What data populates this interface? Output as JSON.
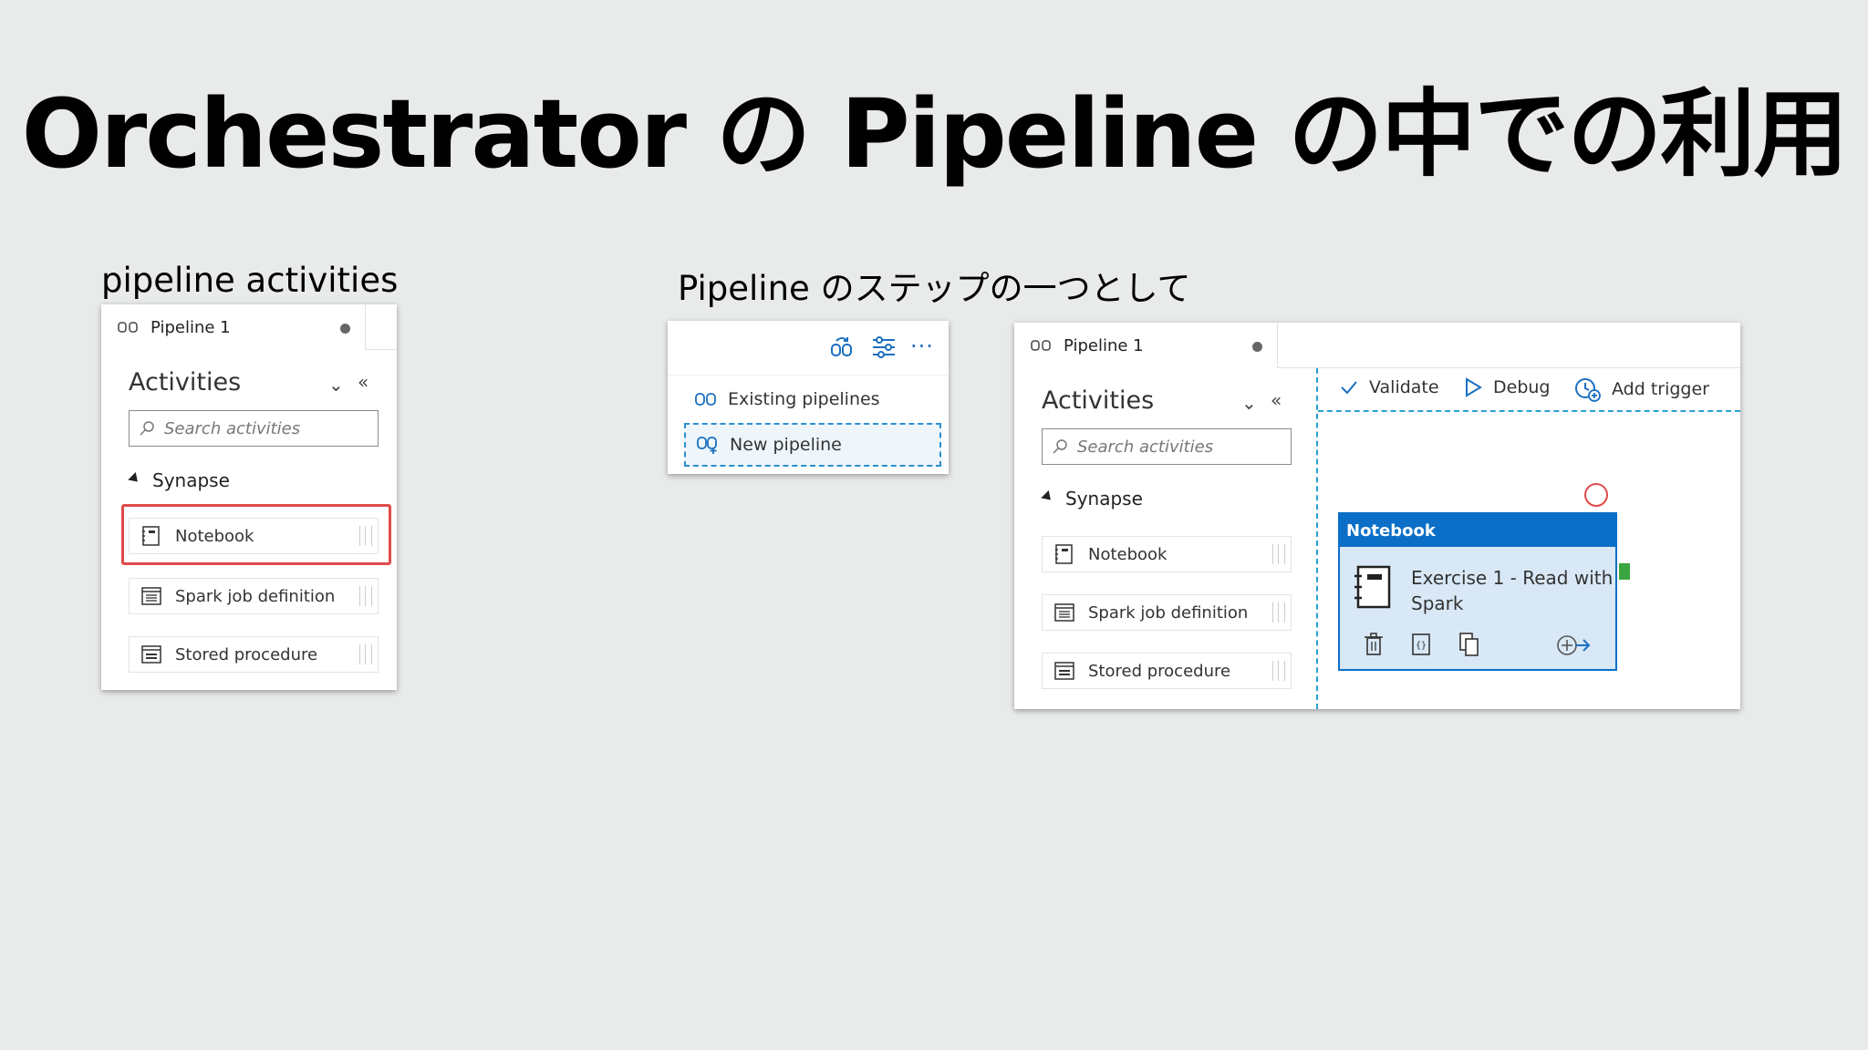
{
  "slide": {
    "title": "Orchestrator の Pipeline の中での利用",
    "left_label": "pipeline activities",
    "middle_label": "Pipeline のステップの一つとして"
  },
  "left_panel": {
    "tab_label": "Pipeline 1",
    "activities_title": "Activities",
    "search_placeholder": "Search activities",
    "group": "Synapse",
    "items": [
      {
        "label": "Notebook",
        "icon": "notebook-icon"
      },
      {
        "label": "Spark job definition",
        "icon": "spark-job-icon"
      },
      {
        "label": "Stored procedure",
        "icon": "stored-procedure-icon"
      }
    ],
    "highlighted_item": "Notebook"
  },
  "menu_panel": {
    "toolbar_icons": [
      "pipeline-add-icon",
      "properties-icon",
      "more-icon"
    ],
    "more_glyph": "···",
    "items": [
      {
        "label": "Existing pipelines",
        "icon": "pipeline-icon"
      },
      {
        "label": "New pipeline",
        "icon": "new-pipeline-icon"
      }
    ]
  },
  "right_panel": {
    "tab_label": "Pipeline 1",
    "activities_title": "Activities",
    "search_placeholder": "Search activities",
    "group": "Synapse",
    "items": [
      {
        "label": "Notebook",
        "icon": "notebook-icon"
      },
      {
        "label": "Spark job definition",
        "icon": "spark-job-icon"
      },
      {
        "label": "Stored procedure",
        "icon": "stored-procedure-icon"
      }
    ],
    "toolbar": {
      "validate": "Validate",
      "debug": "Debug",
      "add_trigger": "Add trigger"
    },
    "node": {
      "type": "Notebook",
      "name": "Exercise 1 - Read with Spark",
      "actions": [
        "delete-icon",
        "code-icon",
        "copy-icon",
        "add-output-icon"
      ]
    }
  },
  "colors": {
    "background": "#e9ebeb",
    "accent": "#0b6fc7",
    "highlight": "#e04a4a",
    "success_port": "#3aa63f"
  }
}
